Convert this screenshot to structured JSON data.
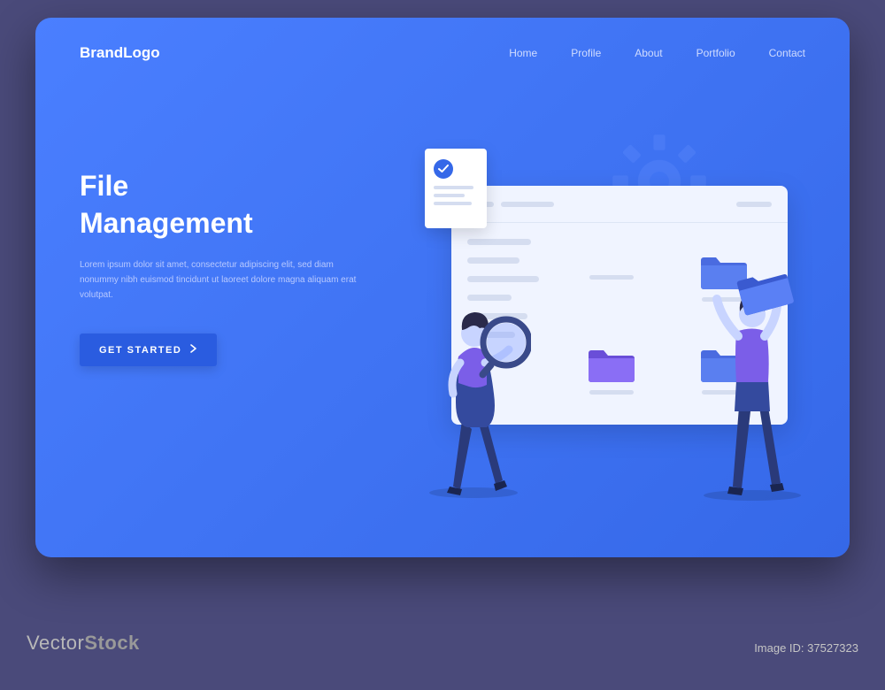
{
  "brand": "BrandLogo",
  "nav": {
    "items": [
      "Home",
      "Profile",
      "About",
      "Portfolio",
      "Contact"
    ]
  },
  "hero": {
    "title": "File\nManagement",
    "body": "Lorem ipsum dolor sit amet, consectetur adipiscing elit, sed diam nonummy nibh euismod tincidunt ut laoreet dolore magna aliquam erat volutpat.",
    "cta": "GET STARTED"
  },
  "watermark": {
    "brand_light": "Vector",
    "brand_bold": "Stock",
    "id": "Image ID: 37527323"
  },
  "colors": {
    "bg": "#4a4a7a",
    "card_start": "#4a7fff",
    "card_end": "#3568e8",
    "accent_purple": "#7b5ee8",
    "folder_blue": "#5a7ff0"
  }
}
